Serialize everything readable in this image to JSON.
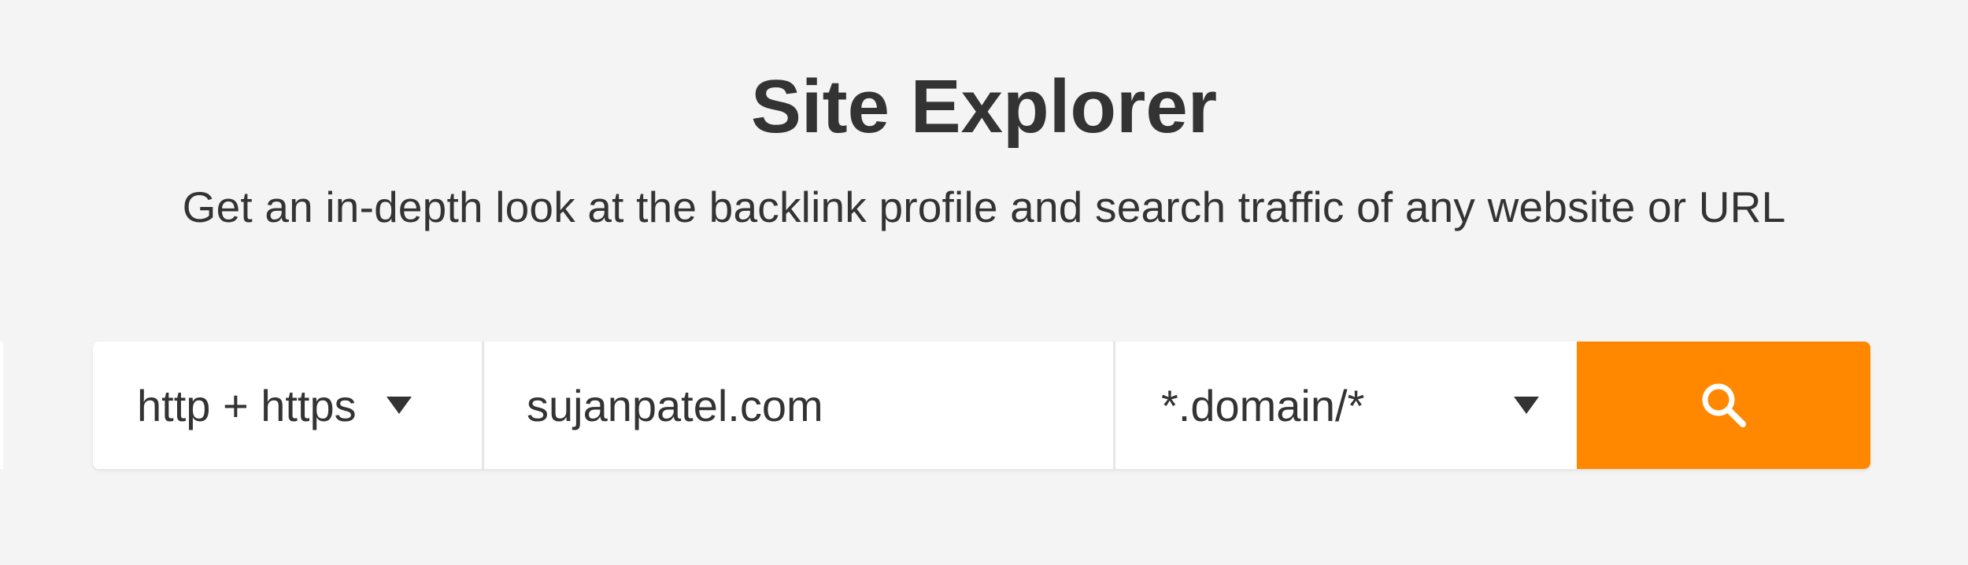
{
  "header": {
    "title": "Site Explorer",
    "subtitle": "Get an in-depth look at the backlink profile and search traffic of any website or URL"
  },
  "search": {
    "protocol": "http + https",
    "url_value": "sujanpatel.com",
    "mode": "*.domain/*",
    "button_icon": "search-icon"
  },
  "colors": {
    "accent": "#ff8800",
    "background": "#f4f4f4",
    "text": "#333333",
    "field_background": "#ffffff"
  }
}
